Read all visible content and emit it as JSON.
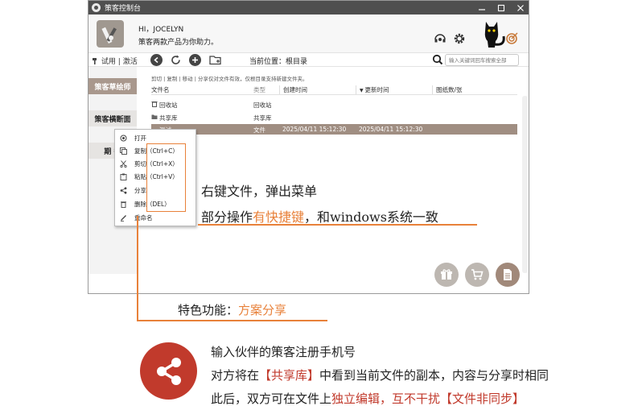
{
  "window": {
    "title": "策客控制台",
    "greeting": "HI，JOCELYN",
    "tagline": "策客两款产品为你助力。"
  },
  "toolbar": {
    "trial": "试用",
    "separator": "|",
    "activate": "激活",
    "current_location": "当前位置：根目录",
    "search_placeholder": "输入关键词回车搜索全部"
  },
  "sidebar": {
    "items": [
      {
        "label": "策客草绘师"
      },
      {
        "label": "策客横断面"
      },
      {
        "label": "期 待"
      }
    ]
  },
  "files": {
    "ops_hint": "剪切 | 复制 | 移动 | 分享仅对文件有效，仅根目录支持新建文件夹。",
    "columns": {
      "name": "文件名",
      "type": "类型",
      "created": "创建时间",
      "updated": "更新时间",
      "size": "图纸数/张"
    },
    "rows": [
      {
        "name": "回收站",
        "type": "回收站",
        "created": "",
        "updated": ""
      },
      {
        "name": "共享库",
        "type": "共享库",
        "created": "",
        "updated": ""
      },
      {
        "name": "测试",
        "type": "文件",
        "created": "2025/04/11 15:12:30",
        "updated": "2025/04/11 15:12:30"
      }
    ]
  },
  "context_menu": {
    "items": [
      {
        "label": "打开",
        "shortcut": ""
      },
      {
        "label": "复制",
        "shortcut": "（Ctrl+C）"
      },
      {
        "label": "剪切",
        "shortcut": "（Ctrl+X）"
      },
      {
        "label": "粘贴",
        "shortcut": "（Ctrl+V）"
      },
      {
        "label": "分享",
        "shortcut": ""
      },
      {
        "label": "删除",
        "shortcut": "（DEL）"
      },
      {
        "label": "重命名",
        "shortcut": ""
      }
    ]
  },
  "annotations": {
    "line1": "右键文件，弹出菜单",
    "line2_prefix": "部分操作",
    "line2_highlight": "有快捷键",
    "line2_suffix": "，和windows系统一致",
    "feature_prefix": "特色功能：",
    "feature_highlight": "方案分享",
    "desc1": "输入伙伴的策客注册手机号",
    "desc2_prefix": "对方将在",
    "desc2_highlight": "【共享库】",
    "desc2_suffix": "中看到当前文件的副本，内容与分享时相同",
    "desc3_prefix": "此后，双方可在文件上",
    "desc3_highlight": "独立编辑，互不干扰【文件非同步】"
  },
  "colors": {
    "accent_orange": "#e8813a",
    "share_red": "#c13a2c",
    "selected_row": "#a08e82",
    "titlebar": "#4f4f4f"
  }
}
